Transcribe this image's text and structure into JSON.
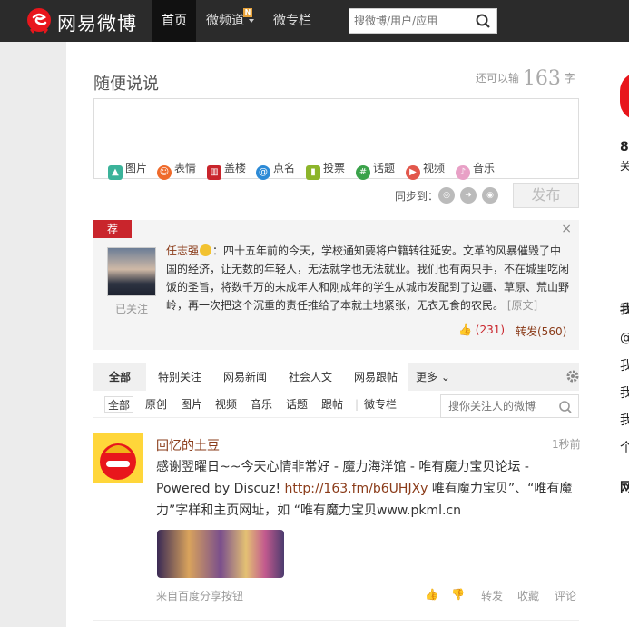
{
  "nav": {
    "logo_text": "网易微博",
    "home": "首页",
    "channel": "微频道",
    "channel_badge": "N",
    "column": "微专栏",
    "search_placeholder": "搜微博/用户/应用"
  },
  "compose": {
    "title": "随便说说",
    "counter_prefix": "还可以输",
    "counter_num": "163",
    "counter_suffix": "字",
    "tools": [
      "图片",
      "表情",
      "盖楼",
      "点名",
      "投票",
      "话题",
      "视频",
      "音乐"
    ],
    "sync_label": "同步到：",
    "post_label": "发布"
  },
  "recommend": {
    "tag": "荐",
    "close": "×",
    "follow_state": "已关注",
    "author": "任志强",
    "text": "：四十五年前的今天，学校通知要将户籍转往延安。文革的风暴催毁了中国的经济，让无数的年轻人，无法就学也无法就业。我们也有两只手，不在城里吃闲饭的圣旨，将数千万的未成年人和刚成年的学生从城市发配到了边疆、草原、荒山野岭，再一次把这个沉重的责任推给了本就土地紧张，无衣无食的农民。",
    "orig_link": "[原文]",
    "likes": "(231)",
    "forward": "转发(560)"
  },
  "tabs": {
    "items": [
      "全部",
      "特别关注",
      "网易新闻",
      "社会人文",
      "网易跟帖",
      "更多"
    ],
    "sub": [
      "全部",
      "原创",
      "图片",
      "视频",
      "音乐",
      "话题",
      "跟帖",
      "微专栏"
    ],
    "filter_placeholder": "搜你关注人的微博"
  },
  "feed": {
    "name": "回忆的土豆",
    "time": "1秒前",
    "text_pre": "感谢翌曜日~~今天心情非常好 - 魔力海洋馆 - 唯有魔力宝贝论坛 - Powered by Discuz! ",
    "link": "http://163.fm/b6UHJXy",
    "text_post": " 唯有魔力宝贝”、“唯有魔力”字样和主页网址，如 “唯有魔力宝贝www.pkml.cn",
    "source": "来自百度分享按钮",
    "forward": "转发",
    "fav": "收藏",
    "comment": "评论"
  },
  "right": {
    "peek_chars": [
      "8",
      "关",
      "我",
      "@",
      "我",
      "我",
      "我",
      "个",
      "网"
    ]
  }
}
